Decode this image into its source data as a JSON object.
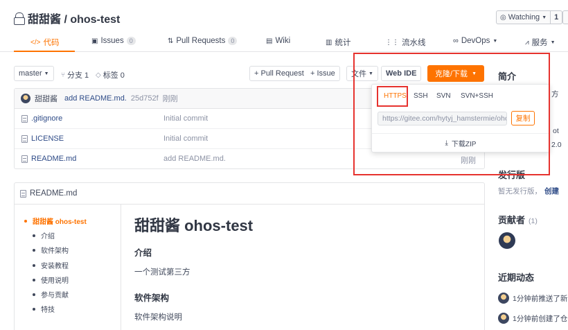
{
  "header": {
    "repo_title": "甜甜酱 / ohos-test",
    "watch_label": "Watching",
    "watch_count": "1"
  },
  "nav": {
    "items": [
      {
        "label": "代码",
        "icon": "code-icon"
      },
      {
        "label": "Issues",
        "badge": "0",
        "icon": "issue-icon"
      },
      {
        "label": "Pull Requests",
        "badge": "0",
        "icon": "pull-request-icon"
      },
      {
        "label": "Wiki",
        "icon": "wiki-icon"
      },
      {
        "label": "统计",
        "icon": "stats-icon"
      },
      {
        "label": "流水线",
        "icon": "pipeline-icon"
      },
      {
        "label": "DevOps",
        "icon": "devops-icon"
      },
      {
        "label": "服务",
        "icon": "service-icon"
      }
    ]
  },
  "toolbar": {
    "branch": "master",
    "branches": "分支 1",
    "tags": "标签 0",
    "pull_request": "+ Pull Request",
    "issue": "+ Issue",
    "file": "文件",
    "web_ide": "Web IDE",
    "clone": "克隆/下载"
  },
  "commit": {
    "author": "甜甜酱",
    "message": "add README.md.",
    "hash": "25d752f",
    "time": "刚刚"
  },
  "files": [
    {
      "name": ".gitignore",
      "message": "Initial commit",
      "time": ""
    },
    {
      "name": "LICENSE",
      "message": "Initial commit",
      "time": ""
    },
    {
      "name": "README.md",
      "message": "add README.md.",
      "time": "刚刚"
    }
  ],
  "readme": {
    "header": "README.md",
    "toc": [
      "甜甜酱 ohos-test",
      "介绍",
      "软件架构",
      "安装教程",
      "使用说明",
      "参与贡献",
      "特技"
    ],
    "title": "甜甜酱 ohos-test",
    "h_intro": "介绍",
    "p_intro": "一个测试第三方",
    "h_arch": "软件架构",
    "p_arch": "软件架构说明"
  },
  "clone_popup": {
    "protocols": [
      "HTTPS",
      "SSH",
      "SVN",
      "SVN+SSH"
    ],
    "url": "https://gitee.com/hytyj_hamstermie/ohos-test.git",
    "copy": "复制",
    "zip": "下载ZIP"
  },
  "sidebar": {
    "intro_title": "简介",
    "intro_frag_1": "方",
    "intro_frag_2": "ot",
    "intro_frag_3": "2.0",
    "release_title": "发行版",
    "release_text": "暂无发行版，",
    "release_create": "创建",
    "contrib_title": "贡献者",
    "contrib_count": "(1)",
    "activity_title": "近期动态",
    "activity_1": "1分钟前推送了新",
    "activity_2": "1分钟前创建了仓"
  },
  "colors": {
    "accent": "#fe7300",
    "highlight_box": "#e6322e",
    "link": "#2e4b87"
  }
}
